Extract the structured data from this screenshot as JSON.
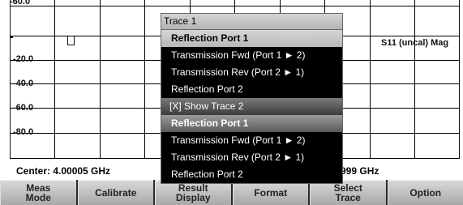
{
  "plot": {
    "top_tick": "-60.0",
    "y_labels": [
      "-20.0",
      "-40.0",
      "-60.0",
      "-80.0"
    ],
    "measurement_label": "S11 (uncal) Mag"
  },
  "status": {
    "center": "Center: 4.00005 GHz",
    "span_partial": "999 GHz"
  },
  "menu": {
    "title": "Trace 1",
    "items": [
      "Reflection Port 1",
      "Transmission Fwd (Port 1 ► 2)",
      "Transmission Rev (Port 2 ► 1)",
      "Reflection Port 2",
      "[X] Show Trace 2",
      "Reflection Port 1",
      "Transmission Fwd (Port 1 ► 2)",
      "Transmission Rev (Port 2 ► 1)",
      "Reflection Port 2"
    ]
  },
  "softkeys": [
    "Meas\nMode",
    "Calibrate",
    "Result\nDisplay",
    "Format",
    "Select\nTrace",
    "Option"
  ]
}
